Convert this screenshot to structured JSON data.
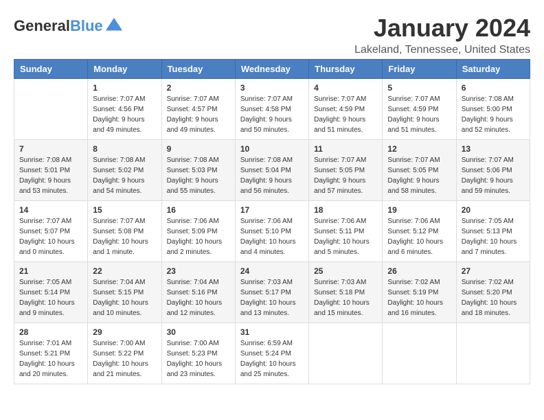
{
  "header": {
    "logo": "GeneralBlue",
    "title": "January 2024",
    "subtitle": "Lakeland, Tennessee, United States"
  },
  "days_of_week": [
    "Sunday",
    "Monday",
    "Tuesday",
    "Wednesday",
    "Thursday",
    "Friday",
    "Saturday"
  ],
  "weeks": [
    [
      {
        "day": "",
        "info": ""
      },
      {
        "day": "1",
        "info": "Sunrise: 7:07 AM\nSunset: 4:56 PM\nDaylight: 9 hours\nand 49 minutes."
      },
      {
        "day": "2",
        "info": "Sunrise: 7:07 AM\nSunset: 4:57 PM\nDaylight: 9 hours\nand 49 minutes."
      },
      {
        "day": "3",
        "info": "Sunrise: 7:07 AM\nSunset: 4:58 PM\nDaylight: 9 hours\nand 50 minutes."
      },
      {
        "day": "4",
        "info": "Sunrise: 7:07 AM\nSunset: 4:59 PM\nDaylight: 9 hours\nand 51 minutes."
      },
      {
        "day": "5",
        "info": "Sunrise: 7:07 AM\nSunset: 4:59 PM\nDaylight: 9 hours\nand 51 minutes."
      },
      {
        "day": "6",
        "info": "Sunrise: 7:08 AM\nSunset: 5:00 PM\nDaylight: 9 hours\nand 52 minutes."
      }
    ],
    [
      {
        "day": "7",
        "info": "Sunrise: 7:08 AM\nSunset: 5:01 PM\nDaylight: 9 hours\nand 53 minutes."
      },
      {
        "day": "8",
        "info": "Sunrise: 7:08 AM\nSunset: 5:02 PM\nDaylight: 9 hours\nand 54 minutes."
      },
      {
        "day": "9",
        "info": "Sunrise: 7:08 AM\nSunset: 5:03 PM\nDaylight: 9 hours\nand 55 minutes."
      },
      {
        "day": "10",
        "info": "Sunrise: 7:08 AM\nSunset: 5:04 PM\nDaylight: 9 hours\nand 56 minutes."
      },
      {
        "day": "11",
        "info": "Sunrise: 7:07 AM\nSunset: 5:05 PM\nDaylight: 9 hours\nand 57 minutes."
      },
      {
        "day": "12",
        "info": "Sunrise: 7:07 AM\nSunset: 5:05 PM\nDaylight: 9 hours\nand 58 minutes."
      },
      {
        "day": "13",
        "info": "Sunrise: 7:07 AM\nSunset: 5:06 PM\nDaylight: 9 hours\nand 59 minutes."
      }
    ],
    [
      {
        "day": "14",
        "info": "Sunrise: 7:07 AM\nSunset: 5:07 PM\nDaylight: 10 hours\nand 0 minutes."
      },
      {
        "day": "15",
        "info": "Sunrise: 7:07 AM\nSunset: 5:08 PM\nDaylight: 10 hours\nand 1 minute."
      },
      {
        "day": "16",
        "info": "Sunrise: 7:06 AM\nSunset: 5:09 PM\nDaylight: 10 hours\nand 2 minutes."
      },
      {
        "day": "17",
        "info": "Sunrise: 7:06 AM\nSunset: 5:10 PM\nDaylight: 10 hours\nand 4 minutes."
      },
      {
        "day": "18",
        "info": "Sunrise: 7:06 AM\nSunset: 5:11 PM\nDaylight: 10 hours\nand 5 minutes."
      },
      {
        "day": "19",
        "info": "Sunrise: 7:06 AM\nSunset: 5:12 PM\nDaylight: 10 hours\nand 6 minutes."
      },
      {
        "day": "20",
        "info": "Sunrise: 7:05 AM\nSunset: 5:13 PM\nDaylight: 10 hours\nand 7 minutes."
      }
    ],
    [
      {
        "day": "21",
        "info": "Sunrise: 7:05 AM\nSunset: 5:14 PM\nDaylight: 10 hours\nand 9 minutes."
      },
      {
        "day": "22",
        "info": "Sunrise: 7:04 AM\nSunset: 5:15 PM\nDaylight: 10 hours\nand 10 minutes."
      },
      {
        "day": "23",
        "info": "Sunrise: 7:04 AM\nSunset: 5:16 PM\nDaylight: 10 hours\nand 12 minutes."
      },
      {
        "day": "24",
        "info": "Sunrise: 7:03 AM\nSunset: 5:17 PM\nDaylight: 10 hours\nand 13 minutes."
      },
      {
        "day": "25",
        "info": "Sunrise: 7:03 AM\nSunset: 5:18 PM\nDaylight: 10 hours\nand 15 minutes."
      },
      {
        "day": "26",
        "info": "Sunrise: 7:02 AM\nSunset: 5:19 PM\nDaylight: 10 hours\nand 16 minutes."
      },
      {
        "day": "27",
        "info": "Sunrise: 7:02 AM\nSunset: 5:20 PM\nDaylight: 10 hours\nand 18 minutes."
      }
    ],
    [
      {
        "day": "28",
        "info": "Sunrise: 7:01 AM\nSunset: 5:21 PM\nDaylight: 10 hours\nand 20 minutes."
      },
      {
        "day": "29",
        "info": "Sunrise: 7:00 AM\nSunset: 5:22 PM\nDaylight: 10 hours\nand 21 minutes."
      },
      {
        "day": "30",
        "info": "Sunrise: 7:00 AM\nSunset: 5:23 PM\nDaylight: 10 hours\nand 23 minutes."
      },
      {
        "day": "31",
        "info": "Sunrise: 6:59 AM\nSunset: 5:24 PM\nDaylight: 10 hours\nand 25 minutes."
      },
      {
        "day": "",
        "info": ""
      },
      {
        "day": "",
        "info": ""
      },
      {
        "day": "",
        "info": ""
      }
    ]
  ]
}
